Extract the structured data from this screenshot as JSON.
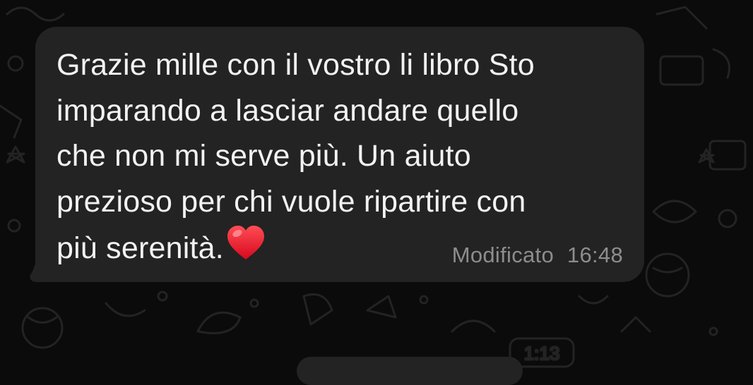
{
  "chat": {
    "background_color": "#0b0b0b",
    "doodle_color": "#232323",
    "wallpaper_badge": "1:13"
  },
  "message": {
    "direction": "incoming",
    "text_lines": [
      "Grazie mille con il vostro li libro Sto",
      "imparando a lasciar andare quello",
      "che non mi serve più. Un aiuto",
      "prezioso per chi vuole ripartire con",
      "più serenità."
    ],
    "emoji": "heart",
    "edited_label": "Modificato",
    "time": "16:48",
    "bubble_color": "#232323",
    "text_color": "#f2f2f2",
    "meta_color": "#8d8d8d"
  }
}
